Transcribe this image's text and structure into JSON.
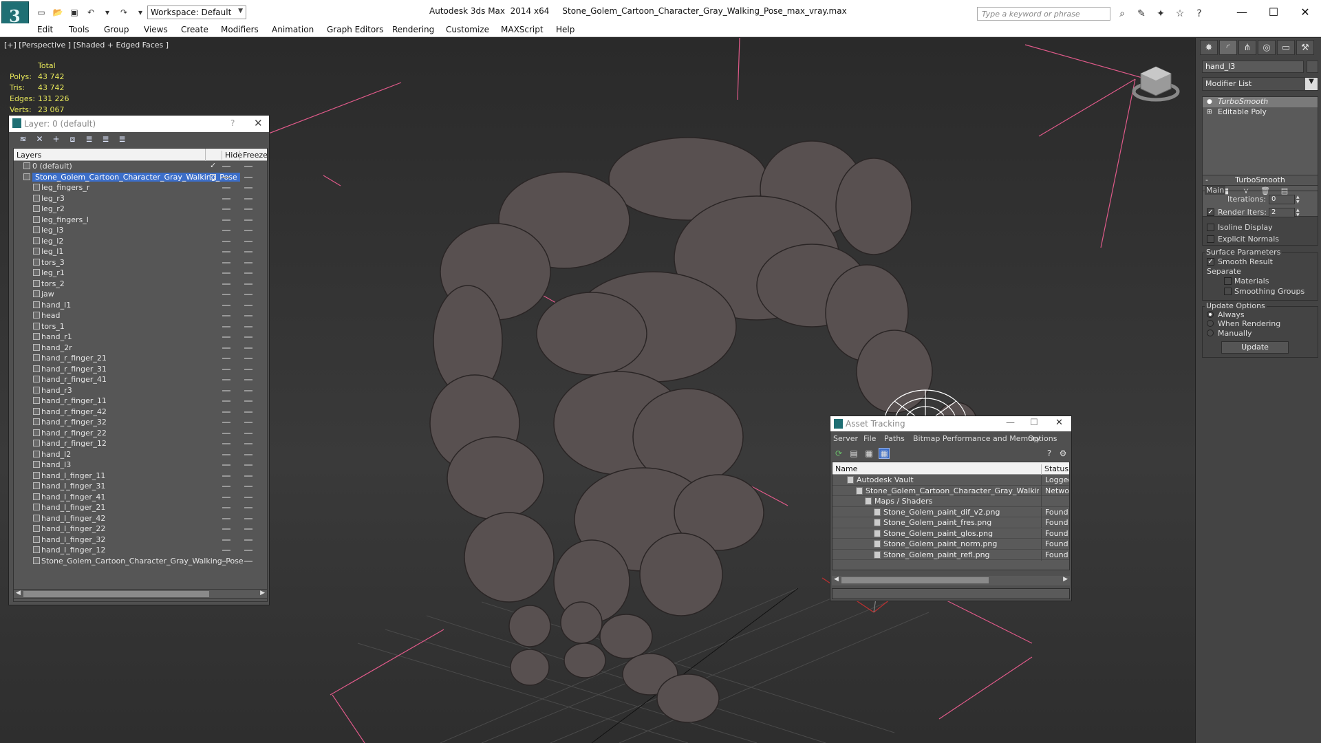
{
  "app": {
    "title": "Autodesk 3ds Max  2014 x64     Stone_Golem_Cartoon_Character_Gray_Walking_Pose_max_vray.max",
    "workspace": "Workspace: Default",
    "search_placeholder": "Type a keyword or phrase",
    "window_controls": [
      "—",
      "☐",
      "✕"
    ]
  },
  "menu": [
    "Edit",
    "Tools",
    "Group",
    "Views",
    "Create",
    "Modifiers",
    "Animation",
    "Graph Editors",
    "Rendering",
    "Customize",
    "MAXScript",
    "Help"
  ],
  "viewport": {
    "label": "[+] [Perspective ] [Shaded + Edged Faces ]",
    "stats": {
      "header": "Total",
      "rows": [
        {
          "label": "Polys:",
          "value": "43 742"
        },
        {
          "label": "Tris:",
          "value": "43 742"
        },
        {
          "label": "Edges:",
          "value": "131 226"
        },
        {
          "label": "Verts:",
          "value": "23 067"
        }
      ]
    }
  },
  "layer_explorer": {
    "title": "Layer: 0 (default)",
    "help": "?",
    "columns": {
      "layers": "Layers",
      "hide": "Hide",
      "freeze": "Freeze"
    },
    "rows": [
      {
        "name": "0 (default)",
        "level": 0,
        "checked": true
      },
      {
        "name": "Stone_Golem_Cartoon_Character_Gray_Walking_Pose",
        "level": 0,
        "selected": true
      },
      {
        "name": "leg_fingers_r",
        "level": 1
      },
      {
        "name": "leg_r3",
        "level": 1
      },
      {
        "name": "leg_r2",
        "level": 1
      },
      {
        "name": "leg_fingers_l",
        "level": 1
      },
      {
        "name": "leg_l3",
        "level": 1
      },
      {
        "name": "leg_l2",
        "level": 1
      },
      {
        "name": "leg_l1",
        "level": 1
      },
      {
        "name": "tors_3",
        "level": 1
      },
      {
        "name": "leg_r1",
        "level": 1
      },
      {
        "name": "tors_2",
        "level": 1
      },
      {
        "name": "jaw",
        "level": 1
      },
      {
        "name": "hand_l1",
        "level": 1
      },
      {
        "name": "head",
        "level": 1
      },
      {
        "name": "tors_1",
        "level": 1
      },
      {
        "name": "hand_r1",
        "level": 1
      },
      {
        "name": "hand_2r",
        "level": 1
      },
      {
        "name": "hand_r_finger_21",
        "level": 1
      },
      {
        "name": "hand_r_finger_31",
        "level": 1
      },
      {
        "name": "hand_r_finger_41",
        "level": 1
      },
      {
        "name": "hand_r3",
        "level": 1
      },
      {
        "name": "hand_r_finger_11",
        "level": 1
      },
      {
        "name": "hand_r_finger_42",
        "level": 1
      },
      {
        "name": "hand_r_finger_32",
        "level": 1
      },
      {
        "name": "hand_r_finger_22",
        "level": 1
      },
      {
        "name": "hand_r_finger_12",
        "level": 1
      },
      {
        "name": "hand_l2",
        "level": 1
      },
      {
        "name": "hand_l3",
        "level": 1
      },
      {
        "name": "hand_l_finger_11",
        "level": 1
      },
      {
        "name": "hand_l_finger_31",
        "level": 1
      },
      {
        "name": "hand_l_finger_41",
        "level": 1
      },
      {
        "name": "hand_l_finger_21",
        "level": 1
      },
      {
        "name": "hand_l_finger_42",
        "level": 1
      },
      {
        "name": "hand_l_finger_22",
        "level": 1
      },
      {
        "name": "hand_l_finger_32",
        "level": 1
      },
      {
        "name": "hand_l_finger_12",
        "level": 1
      },
      {
        "name": "Stone_Golem_Cartoon_Character_Gray_Walking_Pose",
        "level": 1
      }
    ]
  },
  "command_panel": {
    "object_name": "hand_l3",
    "modifier_list": "Modifier List",
    "stack": [
      "TurboSmooth",
      "Editable Poly"
    ],
    "turbosmooth": {
      "header": "TurboSmooth",
      "main_group": "Main",
      "iterations_label": "Iterations:",
      "iterations_value": "0",
      "render_iters_label": "Render Iters:",
      "render_iters_value": "2",
      "render_iters_checked": true,
      "isoline_label": "Isoline Display",
      "explicit_normals_label": "Explicit Normals",
      "surface_group": "Surface Parameters",
      "smooth_result_label": "Smooth Result",
      "separate_label": "Separate",
      "materials_label": "Materials",
      "smoothing_groups_label": "Smoothing Groups",
      "update_group": "Update Options",
      "always_label": "Always",
      "when_rendering_label": "When Rendering",
      "manually_label": "Manually",
      "update_button": "Update"
    }
  },
  "asset_tracking": {
    "title": "Asset Tracking",
    "menu": [
      "Server",
      "File",
      "Paths",
      "Bitmap Performance and Memory",
      "Options"
    ],
    "columns": {
      "name": "Name",
      "status": "Status"
    },
    "rows": [
      {
        "name": "Autodesk Vault",
        "status": "Logged O",
        "level": 1
      },
      {
        "name": "Stone_Golem_Cartoon_Character_Gray_Walking_Pose_ma...",
        "status": "Network",
        "level": 2
      },
      {
        "name": "Maps / Shaders",
        "status": "",
        "level": 3
      },
      {
        "name": "Stone_Golem_paint_dif_v2.png",
        "status": "Found",
        "level": 4
      },
      {
        "name": "Stone_Golem_paint_fres.png",
        "status": "Found",
        "level": 4
      },
      {
        "name": "Stone_Golem_paint_glos.png",
        "status": "Found",
        "level": 4
      },
      {
        "name": "Stone_Golem_paint_norm.png",
        "status": "Found",
        "level": 4
      },
      {
        "name": "Stone_Golem_paint_refl.png",
        "status": "Found",
        "level": 4
      }
    ]
  },
  "colors": {
    "selection_blue": "#3c6ec8",
    "stats_yellow": "#e8e85a",
    "accent_teal": "#1f6f74",
    "gizmo_pink": "#e05a8a"
  }
}
